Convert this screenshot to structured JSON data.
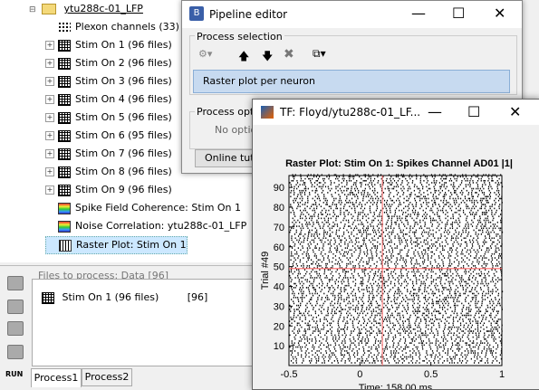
{
  "tree": {
    "root_label": "ytu288c-01_LFP",
    "items": [
      {
        "label": "Plexon channels (33)",
        "icon": "dots-icon",
        "expander": false
      },
      {
        "label": "Stim On 1 (96 files)",
        "icon": "stim-icon",
        "expander": true
      },
      {
        "label": "Stim On 2 (96 files)",
        "icon": "stim-icon",
        "expander": true
      },
      {
        "label": "Stim On 3 (96 files)",
        "icon": "stim-icon",
        "expander": true
      },
      {
        "label": "Stim On 4 (96 files)",
        "icon": "stim-icon",
        "expander": true
      },
      {
        "label": "Stim On 5 (96 files)",
        "icon": "stim-icon",
        "expander": true
      },
      {
        "label": "Stim On 6 (95 files)",
        "icon": "stim-icon",
        "expander": true
      },
      {
        "label": "Stim On 7 (96 files)",
        "icon": "stim-icon",
        "expander": true
      },
      {
        "label": "Stim On 8 (96 files)",
        "icon": "stim-icon",
        "expander": true
      },
      {
        "label": "Stim On 9 (96 files)",
        "icon": "stim-icon",
        "expander": true
      },
      {
        "label": "Spike Field Coherence: Stim On 1",
        "icon": "tf-icon",
        "expander": false
      },
      {
        "label": "Noise Correlation: ytu288c-01_LFP",
        "icon": "tf-icon",
        "expander": false
      },
      {
        "label": "Raster Plot: Stim On 1",
        "icon": "raster-icon",
        "expander": false,
        "selected": true
      }
    ]
  },
  "files_panel": {
    "title": "Files to process: Data [96]",
    "item_label": "Stim On 1 (96 files)",
    "item_count": "[96]",
    "tabs": [
      "Process1",
      "Process2"
    ],
    "run_label": "RUN"
  },
  "pipeline": {
    "title": "Pipeline editor",
    "section_label": "Process selection",
    "process_item": "Raster plot per neuron",
    "options_label": "Process opti",
    "options_text": "No optio",
    "online_button": "Online tuto"
  },
  "tf_window": {
    "title": "TF: Floyd/ytu288c-01_LF..."
  },
  "chart_data": {
    "type": "scatter",
    "title": "Raster Plot: Stim On 1: Spikes Channel AD01 |1|",
    "xlabel": "Time: 158.00 ms",
    "ylabel": "Trial #49",
    "xlim": [
      -0.5,
      1
    ],
    "ylim": [
      0,
      96
    ],
    "xticks": [
      "-0.5",
      "0",
      "0.5",
      "1"
    ],
    "yticks": [
      "10",
      "20",
      "30",
      "40",
      "50",
      "60",
      "70",
      "80",
      "90"
    ],
    "cursor_x": 0.158,
    "cursor_y": 49,
    "marker_color": "#000000",
    "cursor_color": "#ff6666",
    "background": "#ffffff"
  }
}
